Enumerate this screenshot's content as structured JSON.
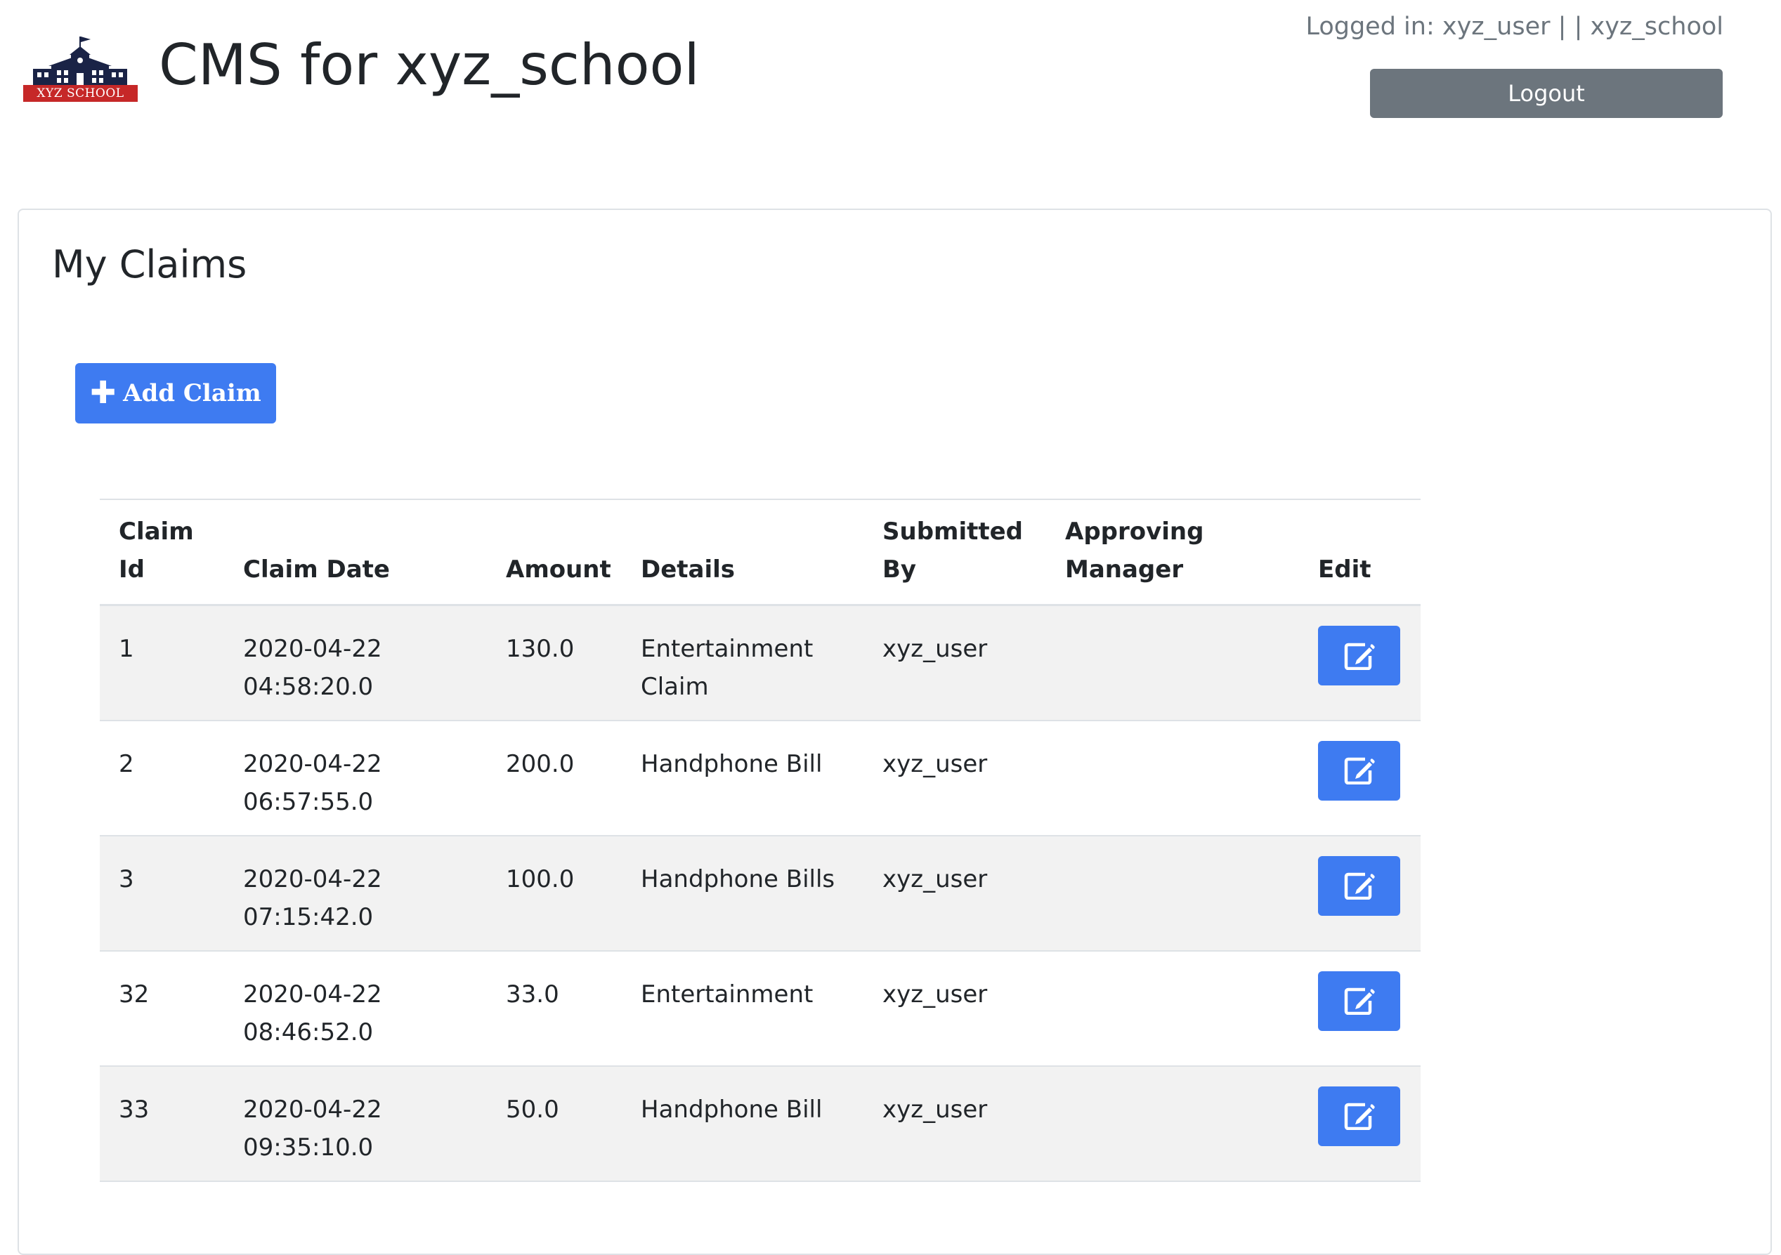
{
  "header": {
    "logo_text": "XYZ SCHOOL",
    "title": "CMS for xyz_school",
    "login_info": "Logged in: xyz_user |  | xyz_school",
    "logout_label": "Logout"
  },
  "main": {
    "heading": "My Claims",
    "add_claim_label": "Add Claim",
    "table": {
      "columns": [
        "Claim Id",
        "Claim Date",
        "Amount",
        "Details",
        "Submitted By",
        "Approving Manager",
        "Edit"
      ],
      "rows": [
        {
          "id": "1",
          "date": "2020-04-22 04:58:20.0",
          "amount": "130.0",
          "details": "Entertainment Claim",
          "submitted_by": "xyz_user",
          "manager": ""
        },
        {
          "id": "2",
          "date": "2020-04-22 06:57:55.0",
          "amount": "200.0",
          "details": "Handphone Bill",
          "submitted_by": "xyz_user",
          "manager": ""
        },
        {
          "id": "3",
          "date": "2020-04-22 07:15:42.0",
          "amount": "100.0",
          "details": "Handphone Bills",
          "submitted_by": "xyz_user",
          "manager": ""
        },
        {
          "id": "32",
          "date": "2020-04-22 08:46:52.0",
          "amount": "33.0",
          "details": "Entertainment",
          "submitted_by": "xyz_user",
          "manager": ""
        },
        {
          "id": "33",
          "date": "2020-04-22 09:35:10.0",
          "amount": "50.0",
          "details": "Handphone Bill",
          "submitted_by": "xyz_user",
          "manager": ""
        }
      ]
    }
  },
  "icons": {
    "logo": "school-building-icon",
    "add": "plus-icon",
    "edit": "edit-pencil-icon"
  },
  "colors": {
    "primary": "#3e7bf1",
    "secondary": "#6c757d",
    "logo_red": "#c62828",
    "logo_navy": "#1a2346",
    "stripe": "#f2f2f2"
  }
}
